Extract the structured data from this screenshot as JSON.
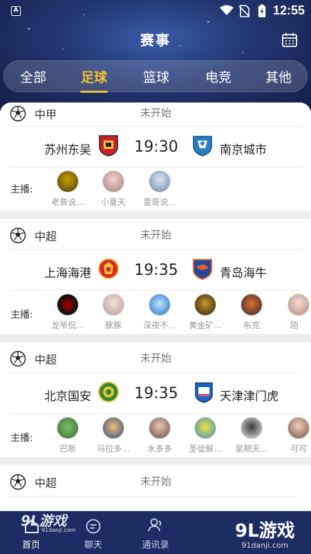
{
  "status_bar": {
    "app_icon": "A",
    "time": "12:55"
  },
  "header": {
    "title": "赛事",
    "tabs": [
      {
        "label": "全部",
        "active": false
      },
      {
        "label": "足球",
        "active": true
      },
      {
        "label": "篮球",
        "active": false
      },
      {
        "label": "电竞",
        "active": false
      },
      {
        "label": "其他",
        "active": false
      }
    ]
  },
  "matches": [
    {
      "league": "中甲",
      "status": "未开始",
      "home": "苏州东吴",
      "time": "19:30",
      "away": "南京城市",
      "anchors_label": "主播:",
      "anchors": [
        "老詹说...",
        "小夏天",
        "雷哥说..."
      ]
    },
    {
      "league": "中超",
      "status": "未开始",
      "home": "上海海港",
      "time": "19:35",
      "away": "青岛海牛",
      "anchors_label": "主播:",
      "anchors": [
        "龙爷侃...",
        "豚豚",
        "深夜不...",
        "黄金矿...",
        "布克",
        "陌"
      ]
    },
    {
      "league": "中超",
      "status": "未开始",
      "home": "北京国安",
      "time": "19:35",
      "away": "天津津门虎",
      "anchors_label": "主播:",
      "anchors": [
        "巴斯",
        "马拉多...",
        "水多多",
        "圣徒解...",
        "星期天...",
        "可可"
      ]
    },
    {
      "league": "中超",
      "status": "未开始"
    }
  ],
  "bottom_nav": [
    {
      "label": "首页",
      "icon": "home-icon",
      "active": true
    },
    {
      "label": "聊天",
      "icon": "chat-icon",
      "active": false
    },
    {
      "label": "通讯录",
      "icon": "contacts-icon",
      "active": false
    }
  ],
  "watermarks": {
    "left_text": "9L游戏",
    "left_sub": "91danji.com",
    "right_text": "9L游戏",
    "right_sub": "91danji.com"
  },
  "colors": {
    "header_bg": "#22356f",
    "active_tab": "#f2c233",
    "nav_bg": "#1d2c63"
  }
}
